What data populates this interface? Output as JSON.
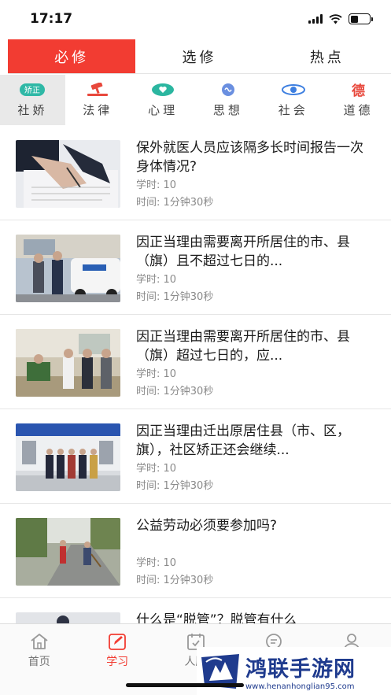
{
  "status": {
    "time": "17:17"
  },
  "top_tabs": [
    {
      "label": "必修",
      "active": true
    },
    {
      "label": "选修",
      "active": false
    },
    {
      "label": "热点",
      "active": false
    }
  ],
  "categories": [
    {
      "label": "社娇",
      "icon": "jiaozheng-badge-icon",
      "icon_text": "矫正",
      "color": "#2fb8a6"
    },
    {
      "label": "法律",
      "icon": "gavel-icon",
      "color": "#e8483c"
    },
    {
      "label": "心理",
      "icon": "heart-bubble-icon",
      "color": "#2bb6a0"
    },
    {
      "label": "思想",
      "icon": "brain-icon",
      "color": "#6a8fe0"
    },
    {
      "label": "社会",
      "icon": "orbit-icon",
      "color": "#3d7fe0"
    },
    {
      "label": "道德",
      "icon": "de-character-icon",
      "icon_text": "德",
      "color": "#e8483c"
    }
  ],
  "articles": [
    {
      "title": "保外就医人员应该隔多长时间报告一次身体情况?",
      "hours": "学时: 10",
      "duration": "时间: 1分钟30秒"
    },
    {
      "title": "因正当理由需要离开所居住的市、县（旗）且不超过七日的...",
      "hours": "学时: 10",
      "duration": "时间: 1分钟30秒"
    },
    {
      "title": "因正当理由需要离开所居住的市、县（旗）超过七日的，应...",
      "hours": "学时: 10",
      "duration": "时间: 1分钟30秒"
    },
    {
      "title": "因正当理由迁出原居住县（市、区，旗），社区矫正还会继续...",
      "hours": "学时: 10",
      "duration": "时间: 1分钟30秒"
    },
    {
      "title": "公益劳动必须要参加吗?",
      "hours": "学时: 10",
      "duration": "时间: 1分钟30秒"
    },
    {
      "title": "什么是“脱管”？脱管有什么",
      "hours": "",
      "duration": ""
    }
  ],
  "bottom_nav": [
    {
      "label": "首页",
      "icon": "home-icon",
      "active": false
    },
    {
      "label": "学习",
      "icon": "edit-icon",
      "active": true
    },
    {
      "label": "人脸",
      "icon": "calendar-icon",
      "active": false
    },
    {
      "label": "",
      "icon": "message-icon",
      "active": false
    },
    {
      "label": "",
      "icon": "user-icon",
      "active": false
    }
  ],
  "watermark": {
    "title": "鸿联手游网",
    "url": "www.henanhonglian95.com"
  },
  "colors": {
    "accent": "#f23c32",
    "watermark": "#1f3b8e"
  }
}
